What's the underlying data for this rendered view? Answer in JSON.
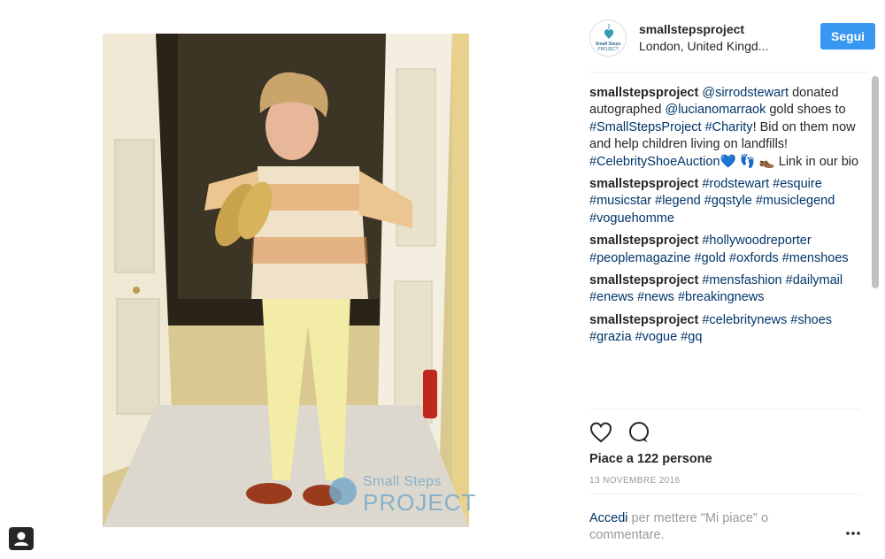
{
  "post": {
    "username": "smallstepsproject",
    "location": "London, United Kingd...",
    "follow_label": "Segui",
    "avatar_text": [
      "Small Steps",
      "PROJECT"
    ],
    "watermark": [
      "Small Steps",
      "PROJECT"
    ]
  },
  "comments": [
    {
      "user": "smallstepsproject",
      "parts": [
        {
          "t": " "
        },
        {
          "t": "@sirrodstewart",
          "link": true
        },
        {
          "t": " donated autographed "
        },
        {
          "t": "@lucianomarraok",
          "link": true
        },
        {
          "t": " gold shoes to "
        },
        {
          "t": "#SmallStepsProject",
          "link": true
        },
        {
          "t": " "
        },
        {
          "t": "#Charity",
          "link": true
        },
        {
          "t": "! Bid on them now and help children living on landfills! "
        },
        {
          "t": "#CelebrityShoeAuction",
          "link": true
        },
        {
          "t": "💙 👣 👞 Link in our bio"
        }
      ]
    },
    {
      "user": "smallstepsproject",
      "parts": [
        {
          "t": " "
        },
        {
          "t": "#rodstewart",
          "link": true
        },
        {
          "t": " "
        },
        {
          "t": "#esquire",
          "link": true
        },
        {
          "t": " "
        },
        {
          "t": "#musicstar",
          "link": true
        },
        {
          "t": " "
        },
        {
          "t": "#legend",
          "link": true
        },
        {
          "t": " "
        },
        {
          "t": "#gqstyle",
          "link": true
        },
        {
          "t": " "
        },
        {
          "t": "#musiclegend",
          "link": true
        },
        {
          "t": " "
        },
        {
          "t": "#voguehomme",
          "link": true
        }
      ]
    },
    {
      "user": "smallstepsproject",
      "parts": [
        {
          "t": " "
        },
        {
          "t": "#hollywoodreporter",
          "link": true
        },
        {
          "t": " "
        },
        {
          "t": "#peoplemagazine",
          "link": true
        },
        {
          "t": " "
        },
        {
          "t": "#gold",
          "link": true
        },
        {
          "t": " "
        },
        {
          "t": "#oxfords",
          "link": true
        },
        {
          "t": " "
        },
        {
          "t": "#menshoes",
          "link": true
        }
      ]
    },
    {
      "user": "smallstepsproject",
      "parts": [
        {
          "t": " "
        },
        {
          "t": "#mensfashion",
          "link": true
        },
        {
          "t": " "
        },
        {
          "t": "#dailymail",
          "link": true
        },
        {
          "t": " "
        },
        {
          "t": "#enews",
          "link": true
        },
        {
          "t": " "
        },
        {
          "t": "#news",
          "link": true
        },
        {
          "t": " "
        },
        {
          "t": "#breakingnews",
          "link": true
        }
      ]
    },
    {
      "user": "smallstepsproject",
      "parts": [
        {
          "t": " "
        },
        {
          "t": "#celebritynews",
          "link": true
        },
        {
          "t": " "
        },
        {
          "t": "#shoes",
          "link": true
        },
        {
          "t": " "
        },
        {
          "t": "#grazia",
          "link": true
        },
        {
          "t": " "
        },
        {
          "t": "#vogue",
          "link": true
        },
        {
          "t": " "
        },
        {
          "t": "#gq",
          "link": true
        }
      ]
    }
  ],
  "actions": {
    "like_icon": "heart-icon",
    "comment_icon": "comment-icon",
    "likes_text": "Piace a 122 persone",
    "date": "13 NOVEMBRE 2016",
    "login_link": "Accedi",
    "login_rest": " per mettere \"Mi piace\" o commentare.",
    "more_icon": "more-options-icon"
  },
  "colors": {
    "link": "#003569",
    "follow_button": "#3897f0",
    "muted": "#999999"
  }
}
